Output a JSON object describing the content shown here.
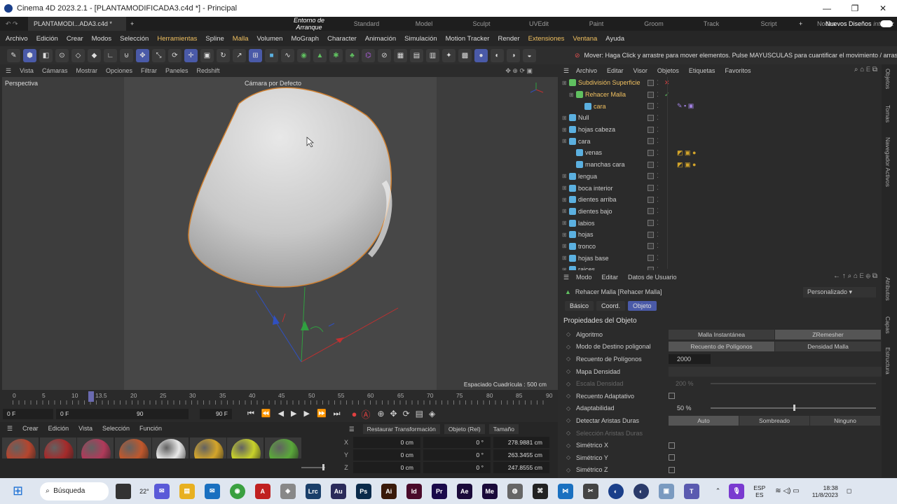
{
  "window": {
    "title": "Cinema 4D 2023.2.1 - [PLANTAMODIFICADA3.c4d *] - Principal"
  },
  "tabs": {
    "doc": "PLANTAMODI...ADA3.c4d *",
    "new_label": "Nuevos Diseños",
    "layouts": [
      "Entorno de Arranque",
      "Standard",
      "Model",
      "Sculpt",
      "UVEdit",
      "Paint",
      "Groom",
      "Track",
      "Script",
      "Nodes",
      "interfaz"
    ]
  },
  "menu": [
    "Archivo",
    "Edición",
    "Crear",
    "Modos",
    "Selección",
    "Herramientas",
    "Spline",
    "Malla",
    "Volumen",
    "MoGraph",
    "Character",
    "Animación",
    "Simulación",
    "Motion Tracker",
    "Render",
    "Extensiones",
    "Ventana",
    "Ayuda"
  ],
  "status": "Mover: Haga Click y arrastre para mover elementos. Pulse MAYUSCULAS para cuantificar el movimiento / arrastre en una zona vacía para seleccionar elementos",
  "viewport": {
    "menu": [
      "Vista",
      "Cámaras",
      "Mostrar",
      "Opciones",
      "Filtrar",
      "Paneles",
      "Redshift"
    ],
    "label": "Perspectiva",
    "camera": "Cámara por Defecto",
    "grid": "Espaciado Cuadrícula : 500 cm"
  },
  "timeline": {
    "ticks": [
      "0",
      "5",
      "10",
      "13.5",
      "20",
      "25",
      "30",
      "35",
      "40",
      "45",
      "50",
      "55",
      "60",
      "65",
      "70",
      "75",
      "80",
      "85",
      "90"
    ],
    "start": "0 F",
    "cur": "0 F",
    "end1": "90 F",
    "end2": "90 F"
  },
  "materials": {
    "menu": [
      "Crear",
      "Edición",
      "Vista",
      "Selección",
      "Función"
    ],
    "colors": [
      "#b5452e",
      "#a52a2a",
      "#b03a5a",
      "#c0582c",
      "#e8e8e8",
      "#d4a52a",
      "#c8d22a",
      "#5aa83a"
    ]
  },
  "coords": {
    "buttons": [
      "Restaurar Transformación",
      "Objeto (Rel)",
      "Tamaño"
    ],
    "rows": [
      {
        "ax": "X",
        "p": "0 cm",
        "r": "0 °",
        "s": "278.9881 cm"
      },
      {
        "ax": "Y",
        "p": "0 cm",
        "r": "0 °",
        "s": "263.3455 cm"
      },
      {
        "ax": "Z",
        "p": "0 cm",
        "r": "0 °",
        "s": "247.8555 cm"
      }
    ]
  },
  "objects": {
    "menu": [
      "Archivo",
      "Editar",
      "Visor",
      "Objetos",
      "Etiquetas",
      "Favoritos"
    ],
    "rows": [
      {
        "n": "Subdivisión Superficie",
        "c": "#f0c060"
      },
      {
        "n": "Rehacer Malla",
        "c": "#f0c060"
      },
      {
        "n": "cara",
        "c": "#f0c060"
      },
      {
        "n": "Null",
        "c": "#ccc"
      },
      {
        "n": "hojas cabeza",
        "c": "#ccc"
      },
      {
        "n": "cara",
        "c": "#ccc"
      },
      {
        "n": "venas",
        "c": "#ccc"
      },
      {
        "n": "manchas cara",
        "c": "#ccc"
      },
      {
        "n": "lengua",
        "c": "#ccc"
      },
      {
        "n": "boca interior",
        "c": "#ccc"
      },
      {
        "n": "dientes arriba",
        "c": "#ccc"
      },
      {
        "n": "dientes bajo",
        "c": "#ccc"
      },
      {
        "n": "labios",
        "c": "#ccc"
      },
      {
        "n": "hojas",
        "c": "#ccc"
      },
      {
        "n": "tronco",
        "c": "#ccc"
      },
      {
        "n": "hojas base",
        "c": "#ccc"
      },
      {
        "n": "raices",
        "c": "#ccc"
      }
    ]
  },
  "attrs": {
    "menu": [
      "Modo",
      "Editar",
      "Datos de Usuario"
    ],
    "title": "Rehacer Malla [Rehacer Malla]",
    "preset": "Personalizado",
    "tabs": [
      "Básico",
      "Coord.",
      "Objeto"
    ],
    "section": "Propiedades del Objeto",
    "algoritmo": "Algoritmo",
    "alg_opts": [
      "Malla Instantánea",
      "ZRemesher"
    ],
    "modo": "Modo de Destino poligonal",
    "modo_opts": [
      "Recuento de Polígonos",
      "Densidad Malla"
    ],
    "recuento": "Recuento de Polígonos",
    "recuento_val": "2000",
    "mapa": "Mapa Densidad",
    "escala": "Escala Densidad",
    "escala_val": "200 %",
    "adapt": "Recuento Adaptativo",
    "adaptab": "Adaptabilidad",
    "adaptab_val": "50 %",
    "detectar": "Detectar Aristas Duras",
    "det_opts": [
      "Auto",
      "Sombreado",
      "Ninguno"
    ],
    "selec": "Selección Aristas Duras",
    "simx": "Simétrico X",
    "simy": "Simétrico Y",
    "simz": "Simétrico Z"
  },
  "side_tabs": [
    "Objetos",
    "Tomas",
    "Navegador Activos",
    "Atributos",
    "Capas",
    "Estructura"
  ],
  "taskbar": {
    "search": "Búsqueda",
    "temp": "22°",
    "lang1": "ESP",
    "lang2": "ES",
    "time": "18:38",
    "date": "11/8/2023"
  }
}
